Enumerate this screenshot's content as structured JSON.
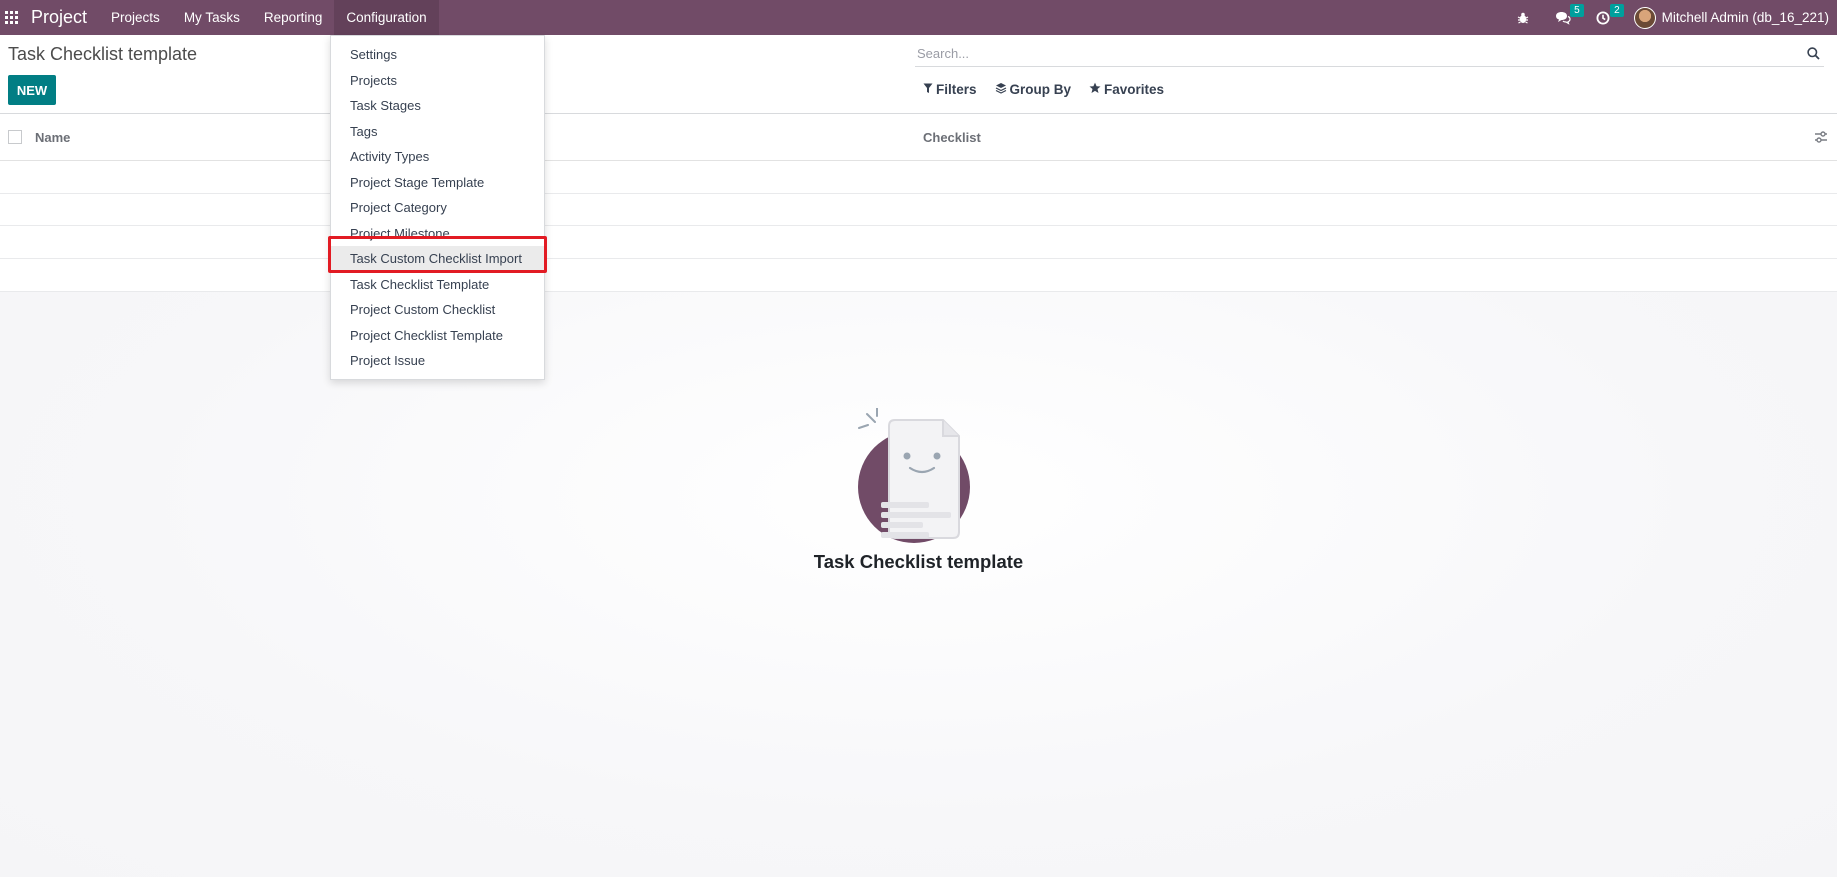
{
  "navbar": {
    "brand": "Project",
    "menu": [
      "Projects",
      "My Tasks",
      "Reporting",
      "Configuration"
    ],
    "active_menu": "Configuration",
    "icons": [
      "apps-grid-icon",
      "bug-icon",
      "chat-icon",
      "clock-activity-icon"
    ],
    "messages_count": "5",
    "activities_count": "2",
    "user_name": "Mitchell Admin (db_16_221)",
    "color": "#714b67"
  },
  "control_panel": {
    "title": "Task Checklist template",
    "new_label": "NEW",
    "search_placeholder": "Search...",
    "filters_label": "Filters",
    "group_by_label": "Group By",
    "favorites_label": "Favorites",
    "accent_color": "#017e84"
  },
  "list": {
    "columns": [
      "Name",
      "Checklist"
    ]
  },
  "empty_state": {
    "title": "Task Checklist template"
  },
  "config_menu": {
    "items": [
      "Settings",
      "Projects",
      "Task Stages",
      "Tags",
      "Activity Types",
      "Project Stage Template",
      "Project Category",
      "Project Milestone",
      "Task Custom Checklist Import",
      "Task Checklist Template",
      "Project Custom Checklist",
      "Project Checklist Template",
      "Project Issue"
    ],
    "highlighted_item": "Task Custom Checklist Import",
    "highlight_color": "#e21b23"
  }
}
